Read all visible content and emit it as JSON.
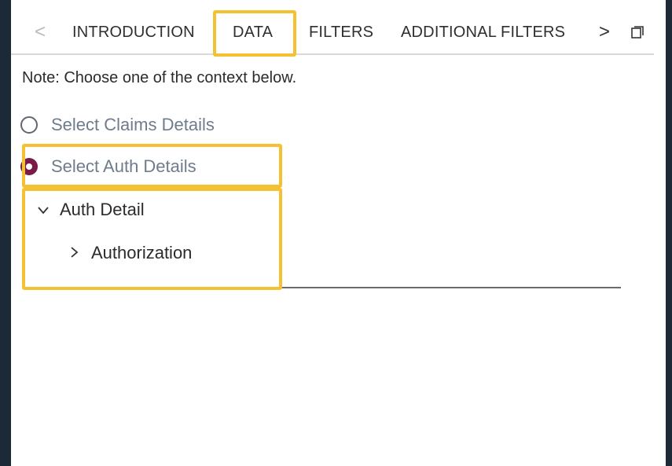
{
  "tabs": {
    "prev_arrow": "<",
    "next_arrow": ">",
    "items": [
      {
        "label": "INTRODUCTION"
      },
      {
        "label": "DATA"
      },
      {
        "label": "FILTERS"
      },
      {
        "label": "ADDITIONAL FILTERS"
      }
    ],
    "active": "DATA"
  },
  "note": "Note: Choose one of the context below.",
  "context_options": [
    {
      "label": "Select Claims Details",
      "selected": false
    },
    {
      "label": "Select Auth Details",
      "selected": true
    }
  ],
  "tree": {
    "root": {
      "label": "Auth Detail",
      "expanded": true,
      "caret": "v"
    },
    "child": {
      "label": "Authorization",
      "expanded": false,
      "caret": ">"
    }
  },
  "colors": {
    "highlight": "#f5c133",
    "radio_selected": "#7a1b49",
    "background": "#1b2a36"
  },
  "icons": {
    "popout": "popout-window-icon"
  }
}
